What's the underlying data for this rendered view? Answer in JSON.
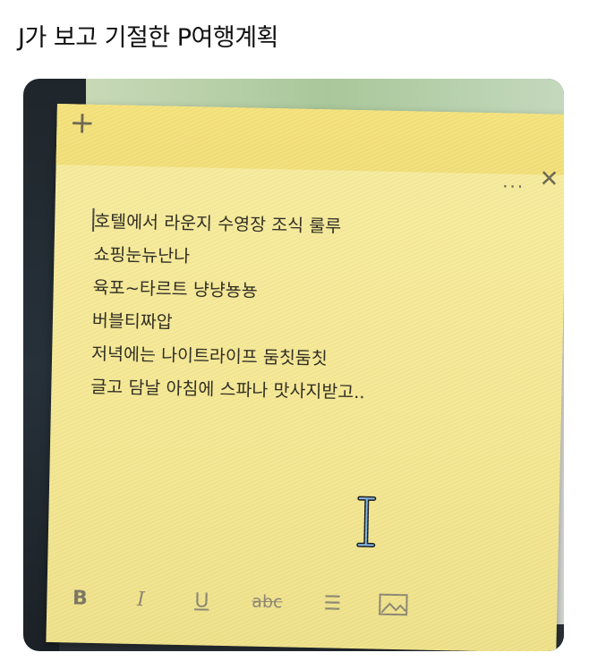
{
  "caption": "J가 보고 기절한 P여행계획",
  "note": {
    "add_label": "+",
    "more_label": "...",
    "close_label": "✕",
    "lines": [
      "호텔에서 라운지 수영장 조식 룰루",
      "쇼핑눈뉴난나",
      "육포~타르트 냥냥뇽뇽",
      "버블티짜압",
      "저녁에는 나이트라이프 둠칫둠칫",
      "글고 담날 아침에 스파나 맛사지받고.."
    ],
    "toolbar": {
      "bold": "B",
      "italic": "I",
      "underline": "U",
      "strikethrough": "abc",
      "list": "☰"
    }
  },
  "colors": {
    "note_yellow": "#f7ec9e",
    "header_yellow": "#f2df78",
    "ibeam_blue": "#7fb6e6"
  },
  "icons": [
    "plus-icon",
    "more-icon",
    "close-icon",
    "ibeam-cursor-icon",
    "bullet-list-icon",
    "image-icon"
  ]
}
